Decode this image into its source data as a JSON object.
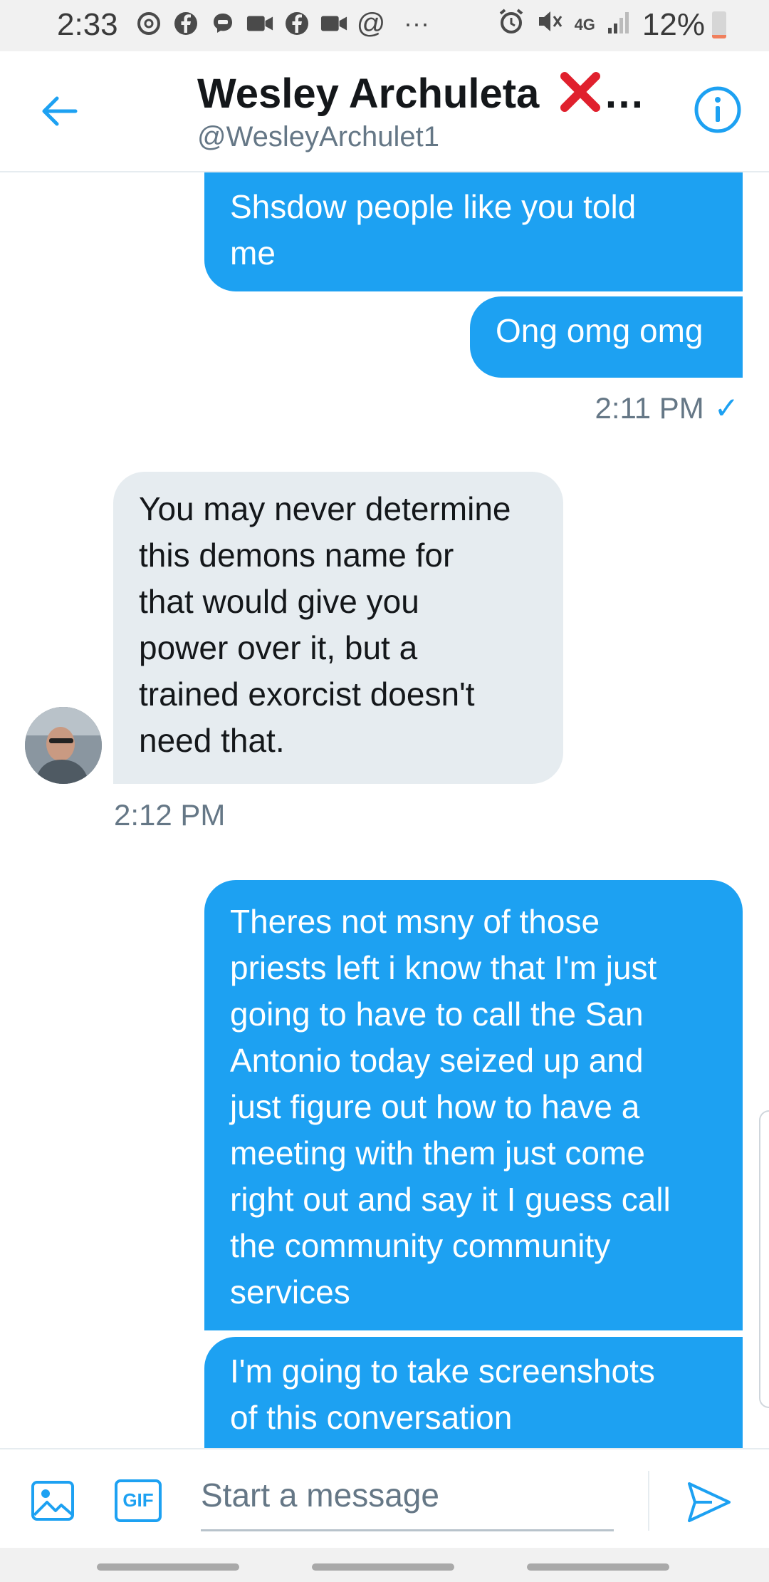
{
  "status_bar": {
    "time": "2:33",
    "network": "4G",
    "battery_percent": "12%",
    "battery_level": 0.12,
    "notification_icons": [
      "threads-icon",
      "facebook-icon",
      "messenger-icon",
      "video-icon",
      "facebook-icon",
      "video-icon",
      "at-icon",
      "more-icon"
    ]
  },
  "header": {
    "name": "Wesley Archuleta",
    "name_suffix": "…",
    "handle": "@WesleyArchulet1"
  },
  "messages": [
    {
      "direction": "sent",
      "text": "Shsdow people like you told\nme"
    },
    {
      "direction": "sent",
      "text": "Ong omg omg"
    },
    {
      "direction": "sent_time",
      "text": "2:11 PM",
      "check": "✓"
    },
    {
      "direction": "received",
      "text": "You may never determine\nthis demons name for\nthat would give you\npower over it, but a\ntrained exorcist doesn't\nneed that."
    },
    {
      "direction": "received_time",
      "text": "2:12 PM"
    },
    {
      "direction": "sent",
      "text": "Theres not msny of those\npriests left i know that I'm just\ngoing to have to call the San\nAntonio today seized up and\njust figure out how to have a\nmeeting with them just come\nright out and say it I guess call\nthe community community\nservices"
    },
    {
      "direction": "sent",
      "text": "I'm going to take screenshots\nof this conversation"
    }
  ],
  "composer": {
    "placeholder": "Start a message",
    "gif_label": "GIF"
  },
  "colors": {
    "accent": "#1da1f2",
    "received_bubble": "#e6ecf0",
    "secondary_text": "#657786"
  }
}
